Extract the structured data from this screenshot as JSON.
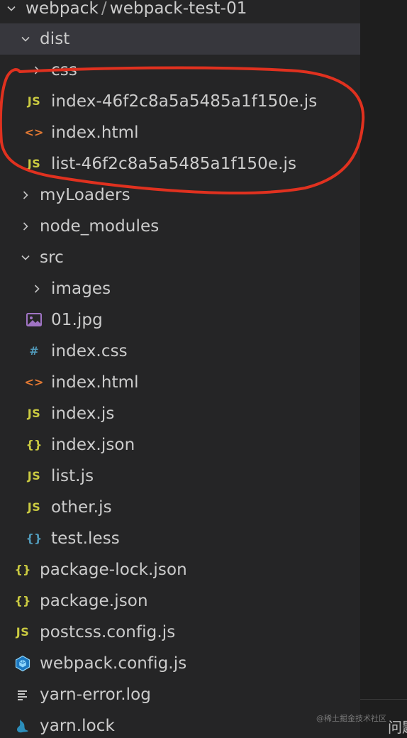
{
  "explorer": {
    "root": {
      "project": "webpack",
      "separator": "/",
      "name": "webpack-test-01"
    },
    "items": [
      {
        "name": "dist",
        "type": "folder",
        "expanded": true,
        "depth": 1,
        "icon": "chevron-down-icon",
        "selected": true
      },
      {
        "name": "css",
        "type": "folder",
        "expanded": false,
        "depth": 2,
        "icon": "chevron-right-icon"
      },
      {
        "name": "index-46f2c8a5a5485a1f150e.js",
        "type": "file",
        "depth": 2,
        "icon": "js-file-icon",
        "icon_text": "JS"
      },
      {
        "name": "index.html",
        "type": "file",
        "depth": 2,
        "icon": "html-file-icon",
        "icon_text": "<>"
      },
      {
        "name": "list-46f2c8a5a5485a1f150e.js",
        "type": "file",
        "depth": 2,
        "icon": "js-file-icon",
        "icon_text": "JS"
      },
      {
        "name": "myLoaders",
        "type": "folder",
        "expanded": false,
        "depth": 1,
        "icon": "chevron-right-icon"
      },
      {
        "name": "node_modules",
        "type": "folder",
        "expanded": false,
        "depth": 1,
        "icon": "chevron-right-icon"
      },
      {
        "name": "src",
        "type": "folder",
        "expanded": true,
        "depth": 1,
        "icon": "chevron-down-icon"
      },
      {
        "name": "images",
        "type": "folder",
        "expanded": false,
        "depth": 2,
        "icon": "chevron-right-icon"
      },
      {
        "name": "01.jpg",
        "type": "file",
        "depth": 2,
        "icon": "image-file-icon"
      },
      {
        "name": "index.css",
        "type": "file",
        "depth": 2,
        "icon": "css-file-icon",
        "icon_text": "#"
      },
      {
        "name": "index.html",
        "type": "file",
        "depth": 2,
        "icon": "html-file-icon",
        "icon_text": "<>"
      },
      {
        "name": "index.js",
        "type": "file",
        "depth": 2,
        "icon": "js-file-icon",
        "icon_text": "JS"
      },
      {
        "name": "index.json",
        "type": "file",
        "depth": 2,
        "icon": "json-file-icon",
        "icon_text": "{}"
      },
      {
        "name": "list.js",
        "type": "file",
        "depth": 2,
        "icon": "js-file-icon",
        "icon_text": "JS"
      },
      {
        "name": "other.js",
        "type": "file",
        "depth": 2,
        "icon": "js-file-icon",
        "icon_text": "JS"
      },
      {
        "name": "test.less",
        "type": "file",
        "depth": 2,
        "icon": "less-file-icon",
        "icon_text": "{}"
      },
      {
        "name": "package-lock.json",
        "type": "file",
        "depth": 1,
        "icon": "json-file-icon",
        "icon_text": "{}"
      },
      {
        "name": "package.json",
        "type": "file",
        "depth": 1,
        "icon": "json-file-icon",
        "icon_text": "{}"
      },
      {
        "name": "postcss.config.js",
        "type": "file",
        "depth": 1,
        "icon": "js-file-icon",
        "icon_text": "JS"
      },
      {
        "name": "webpack.config.js",
        "type": "file",
        "depth": 1,
        "icon": "webpack-file-icon"
      },
      {
        "name": "yarn-error.log",
        "type": "file",
        "depth": 1,
        "icon": "log-file-icon"
      },
      {
        "name": "yarn.lock",
        "type": "file",
        "depth": 1,
        "icon": "yarn-file-icon"
      }
    ]
  },
  "overlay": {
    "watermark": "@稀土掘金技术社区",
    "cut_text": "问题",
    "annotation_color": "#e0311f"
  }
}
